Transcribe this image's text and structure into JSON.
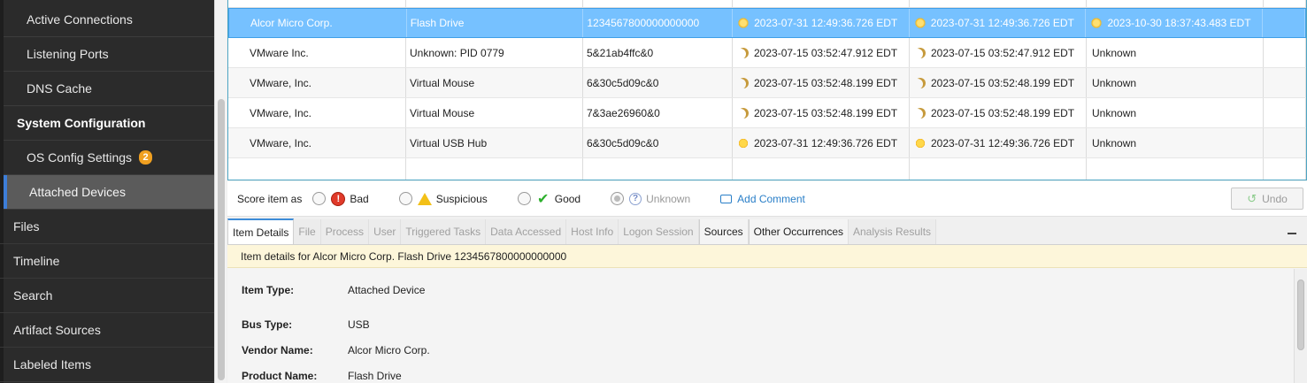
{
  "sidebar": {
    "items": [
      {
        "label": "Active Connections"
      },
      {
        "label": "Listening Ports"
      },
      {
        "label": "DNS Cache"
      },
      {
        "label": "System Configuration"
      },
      {
        "label": "OS Config Settings",
        "badge": "2"
      },
      {
        "label": "Attached Devices"
      },
      {
        "label": "Files"
      },
      {
        "label": "Timeline"
      },
      {
        "label": "Search"
      },
      {
        "label": "Artifact Sources"
      },
      {
        "label": "Labeled Items"
      }
    ]
  },
  "grid": {
    "rows": [
      {
        "vendor": "Alcor Micro Corp.",
        "product": "Flash Drive",
        "serial": "1234567800000000000",
        "first": "2023-07-31 12:49:36.726 EDT",
        "last": "2023-07-31 12:49:36.726 EDT",
        "removed": "2023-10-30 18:37:43.483 EDT",
        "icon": "sunset-icon",
        "selected": true
      },
      {
        "vendor": "VMware Inc.",
        "product": "Unknown: PID 0779",
        "serial": "5&21ab4ffc&0",
        "first": "2023-07-15 03:52:47.912 EDT",
        "last": "2023-07-15 03:52:47.912 EDT",
        "removed": "Unknown",
        "icon": "moon-icon"
      },
      {
        "vendor": "VMware, Inc.",
        "product": "Virtual Mouse",
        "serial": "6&30c5d09c&0",
        "first": "2023-07-15 03:52:48.199 EDT",
        "last": "2023-07-15 03:52:48.199 EDT",
        "removed": "Unknown",
        "icon": "moon-icon"
      },
      {
        "vendor": "VMware, Inc.",
        "product": "Virtual Mouse",
        "serial": "7&3ae26960&0",
        "first": "2023-07-15 03:52:48.199 EDT",
        "last": "2023-07-15 03:52:48.199 EDT",
        "removed": "Unknown",
        "icon": "moon-icon"
      },
      {
        "vendor": "VMware, Inc.",
        "product": "Virtual USB Hub",
        "serial": "6&30c5d09c&0",
        "first": "2023-07-31 12:49:36.726 EDT",
        "last": "2023-07-31 12:49:36.726 EDT",
        "removed": "Unknown",
        "icon": "sun-icon"
      }
    ]
  },
  "score": {
    "label": "Score item as",
    "bad": "Bad",
    "suspicious": "Suspicious",
    "good": "Good",
    "unknown": "Unknown",
    "add_comment": "Add Comment",
    "undo": "Undo"
  },
  "details": {
    "tabs": [
      "Item Details",
      "File",
      "Process",
      "User",
      "Triggered Tasks",
      "Data Accessed",
      "Host Info",
      "Logon Session",
      "Sources",
      "Other Occurrences",
      "Analysis Results"
    ],
    "banner": "Item details for Alcor Micro Corp. Flash Drive 1234567800000000000",
    "props": [
      {
        "key": "Item Type:",
        "value": "Attached Device"
      },
      {
        "key": "Bus Type:",
        "value": "USB"
      },
      {
        "key": "Vendor Name:",
        "value": "Alcor Micro Corp."
      },
      {
        "key": "Product Name:",
        "value": "Flash Drive"
      }
    ]
  },
  "colors": {
    "selected_row": "#76c1ff",
    "badge": "#f0a020",
    "accent": "#3d7ed8",
    "banner": "#fdf6da"
  }
}
